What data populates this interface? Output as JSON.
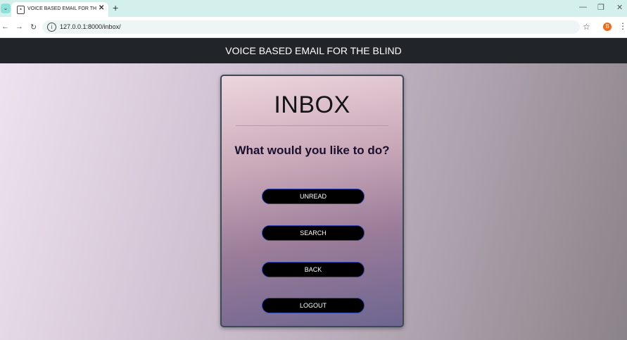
{
  "browser": {
    "tab_title": "VOICE BASED EMAIL FOR THE B",
    "url": "127.0.0.1:8000/inbox/",
    "profile_initial": "B"
  },
  "app": {
    "header_title": "VOICE BASED EMAIL FOR THE BLIND"
  },
  "inbox": {
    "title": "INBOX",
    "prompt": "What would you like to do?",
    "buttons": {
      "unread": "UNREAD",
      "search": "SEARCH",
      "back": "BACK",
      "logout": "LOGOUT"
    }
  }
}
